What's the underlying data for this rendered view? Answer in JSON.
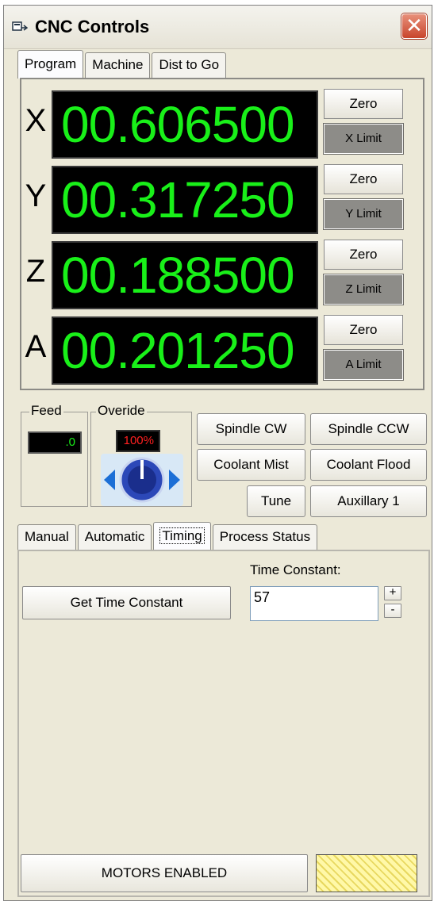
{
  "window": {
    "title": "CNC Controls",
    "close_icon": "close-icon"
  },
  "top_tabs": [
    "Program",
    "Machine",
    "Dist to Go"
  ],
  "axes": [
    {
      "letter": "X",
      "value": "00.606500",
      "zero_label": "Zero",
      "limit_label": "X Limit"
    },
    {
      "letter": "Y",
      "value": "00.317250",
      "zero_label": "Zero",
      "limit_label": "Y Limit"
    },
    {
      "letter": "Z",
      "value": "00.188500",
      "zero_label": "Zero",
      "limit_label": "Z Limit"
    },
    {
      "letter": "A",
      "value": "00.201250",
      "zero_label": "Zero",
      "limit_label": "A Limit"
    }
  ],
  "feed": {
    "label": "Feed",
    "value": ".0"
  },
  "override": {
    "label": "Overide",
    "value": "100%"
  },
  "controls": {
    "spindle_cw": "Spindle CW",
    "spindle_ccw": "Spindle CCW",
    "coolant_mist": "Coolant Mist",
    "coolant_flood": "Coolant Flood",
    "tune": "Tune",
    "auxillary": "Auxillary 1"
  },
  "bottom_tabs": [
    "Manual",
    "Automatic",
    "Timing",
    "Process Status"
  ],
  "timing": {
    "get_time_constant": "Get Time Constant",
    "time_constant_label": "Time Constant:",
    "time_constant_value": "57",
    "increment": "+",
    "decrement": "-"
  },
  "status": {
    "motors": "MOTORS ENABLED"
  },
  "colors": {
    "dro_text": "#19f019",
    "dro_bg": "#000000",
    "override_text": "#ff2020",
    "feed_text": "#19f019"
  }
}
